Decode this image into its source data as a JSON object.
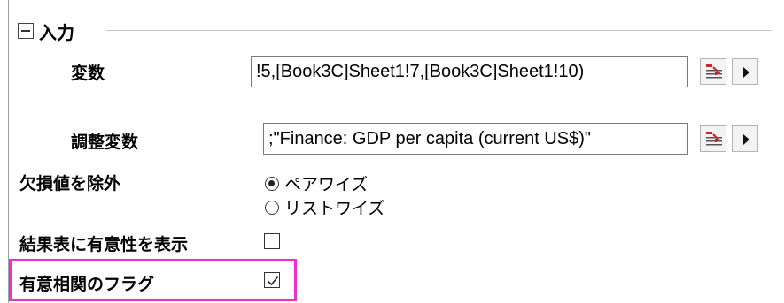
{
  "input_group": {
    "title": "入力",
    "variables": {
      "label": "変数",
      "value": "!5,[Book3C]Sheet1!7,[Book3C]Sheet1!10)"
    },
    "control_variables": {
      "label": "調整変数",
      "value": ";\"Finance: GDP per capita (current US$)\""
    }
  },
  "exclude_missing": {
    "label": "欠損値を除外",
    "options": [
      {
        "label": "ペアワイズ",
        "selected": true
      },
      {
        "label": "リストワイズ",
        "selected": false
      }
    ]
  },
  "show_significance": {
    "label": "結果表に有意性を表示",
    "checked": false
  },
  "flag_significant": {
    "label": "有意相関のフラグ",
    "checked": true
  },
  "colors": {
    "highlight": "#e832c8",
    "range_icon": "#d4202a"
  }
}
